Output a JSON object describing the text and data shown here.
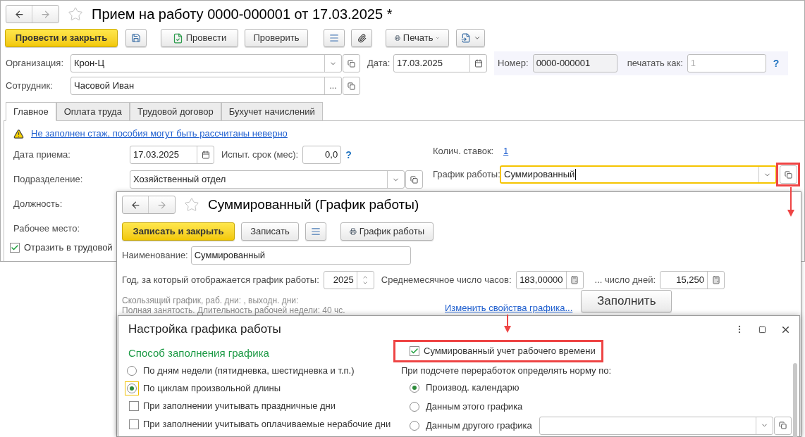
{
  "main_window": {
    "title": "Прием на работу 0000-000001 от 17.03.2025 *",
    "toolbar": {
      "post_and_close": "Провести и закрыть",
      "post": "Провести",
      "check": "Проверить",
      "print": "Печать"
    },
    "organization": {
      "label": "Организация:",
      "value": "Крон-Ц"
    },
    "date": {
      "label": "Дата:",
      "value": "17.03.2025"
    },
    "number": {
      "label": "Номер:",
      "value": "0000-000001"
    },
    "print_as": {
      "label": "печатать как:",
      "placeholder": "1",
      "help": "?"
    },
    "employee": {
      "label": "Сотрудник:",
      "value": "Часовой Иван",
      "select": "..."
    },
    "tabs": [
      {
        "label": "Главное",
        "selected": true
      },
      {
        "label": "Оплата труда",
        "selected": false
      },
      {
        "label": "Трудовой договор",
        "selected": false
      },
      {
        "label": "Бухучет начислений",
        "selected": false
      }
    ],
    "warning": "Не заполнен стаж, пособия могут быть рассчитаны неверно",
    "hire_date": {
      "label": "Дата приема:",
      "value": "17.03.2025"
    },
    "probation": {
      "label": "Испыт. срок (мес):",
      "value": "0,0",
      "help": "?"
    },
    "department": {
      "label": "Подразделение:",
      "value": "Хозяйственный отдел"
    },
    "position": {
      "label": "Должность:"
    },
    "workplace": {
      "label": "Рабочее место:"
    },
    "labor_book": {
      "label": "Отразить в трудовой",
      "checked": true
    },
    "rates": {
      "label": "Колич. ставок:",
      "value": "1"
    },
    "schedule": {
      "label": "График работы:",
      "value": "Суммированный",
      "focused": true
    }
  },
  "schedule_window": {
    "title": "Суммированный (График работы)",
    "toolbar": {
      "save_and_close": "Записать и закрыть",
      "save": "Записать",
      "print": "График работы"
    },
    "name": {
      "label": "Наименование:",
      "value": "Суммированный"
    },
    "year": {
      "label": "Год, за который отображается график работы:",
      "value": "2025"
    },
    "avg_hours": {
      "label": "Среднемесячное число часов:",
      "value": "183,00000"
    },
    "avg_days": {
      "label": "... число дней:",
      "value": "15,250"
    },
    "info": [
      "Скользящий график, раб. дни: , выходн. дни:",
      "Полная занятость. Длительность рабочей недели: 40 чс."
    ],
    "change_link": "Изменить свойства графика...",
    "fill_button": "Заполнить"
  },
  "settings_dialog": {
    "title": "Настройка графика работы",
    "fill_method": {
      "heading": "Способ заполнения графика",
      "options": [
        {
          "label": "По дням недели (пятидневка, шестидневка и т.п.)",
          "selected": false,
          "focused": false
        },
        {
          "label": "По циклам произвольной длины",
          "selected": true,
          "focused": true
        }
      ]
    },
    "fill_checks": [
      {
        "label": "При заполнении учитывать праздничные дни",
        "checked": false
      },
      {
        "label": "При заполнении учитывать оплачиваемые нерабочие дни",
        "checked": false
      }
    ],
    "summarized": {
      "label": "Суммированный учет рабочего времени",
      "checked": true
    },
    "norm": {
      "label": "При подсчете переработок определять норму по:",
      "options": [
        {
          "label": "Производ. календарю",
          "selected": true
        },
        {
          "label": "Данным этого графика",
          "selected": false
        },
        {
          "label": "Данным другого графика",
          "selected": false
        }
      ]
    }
  }
}
